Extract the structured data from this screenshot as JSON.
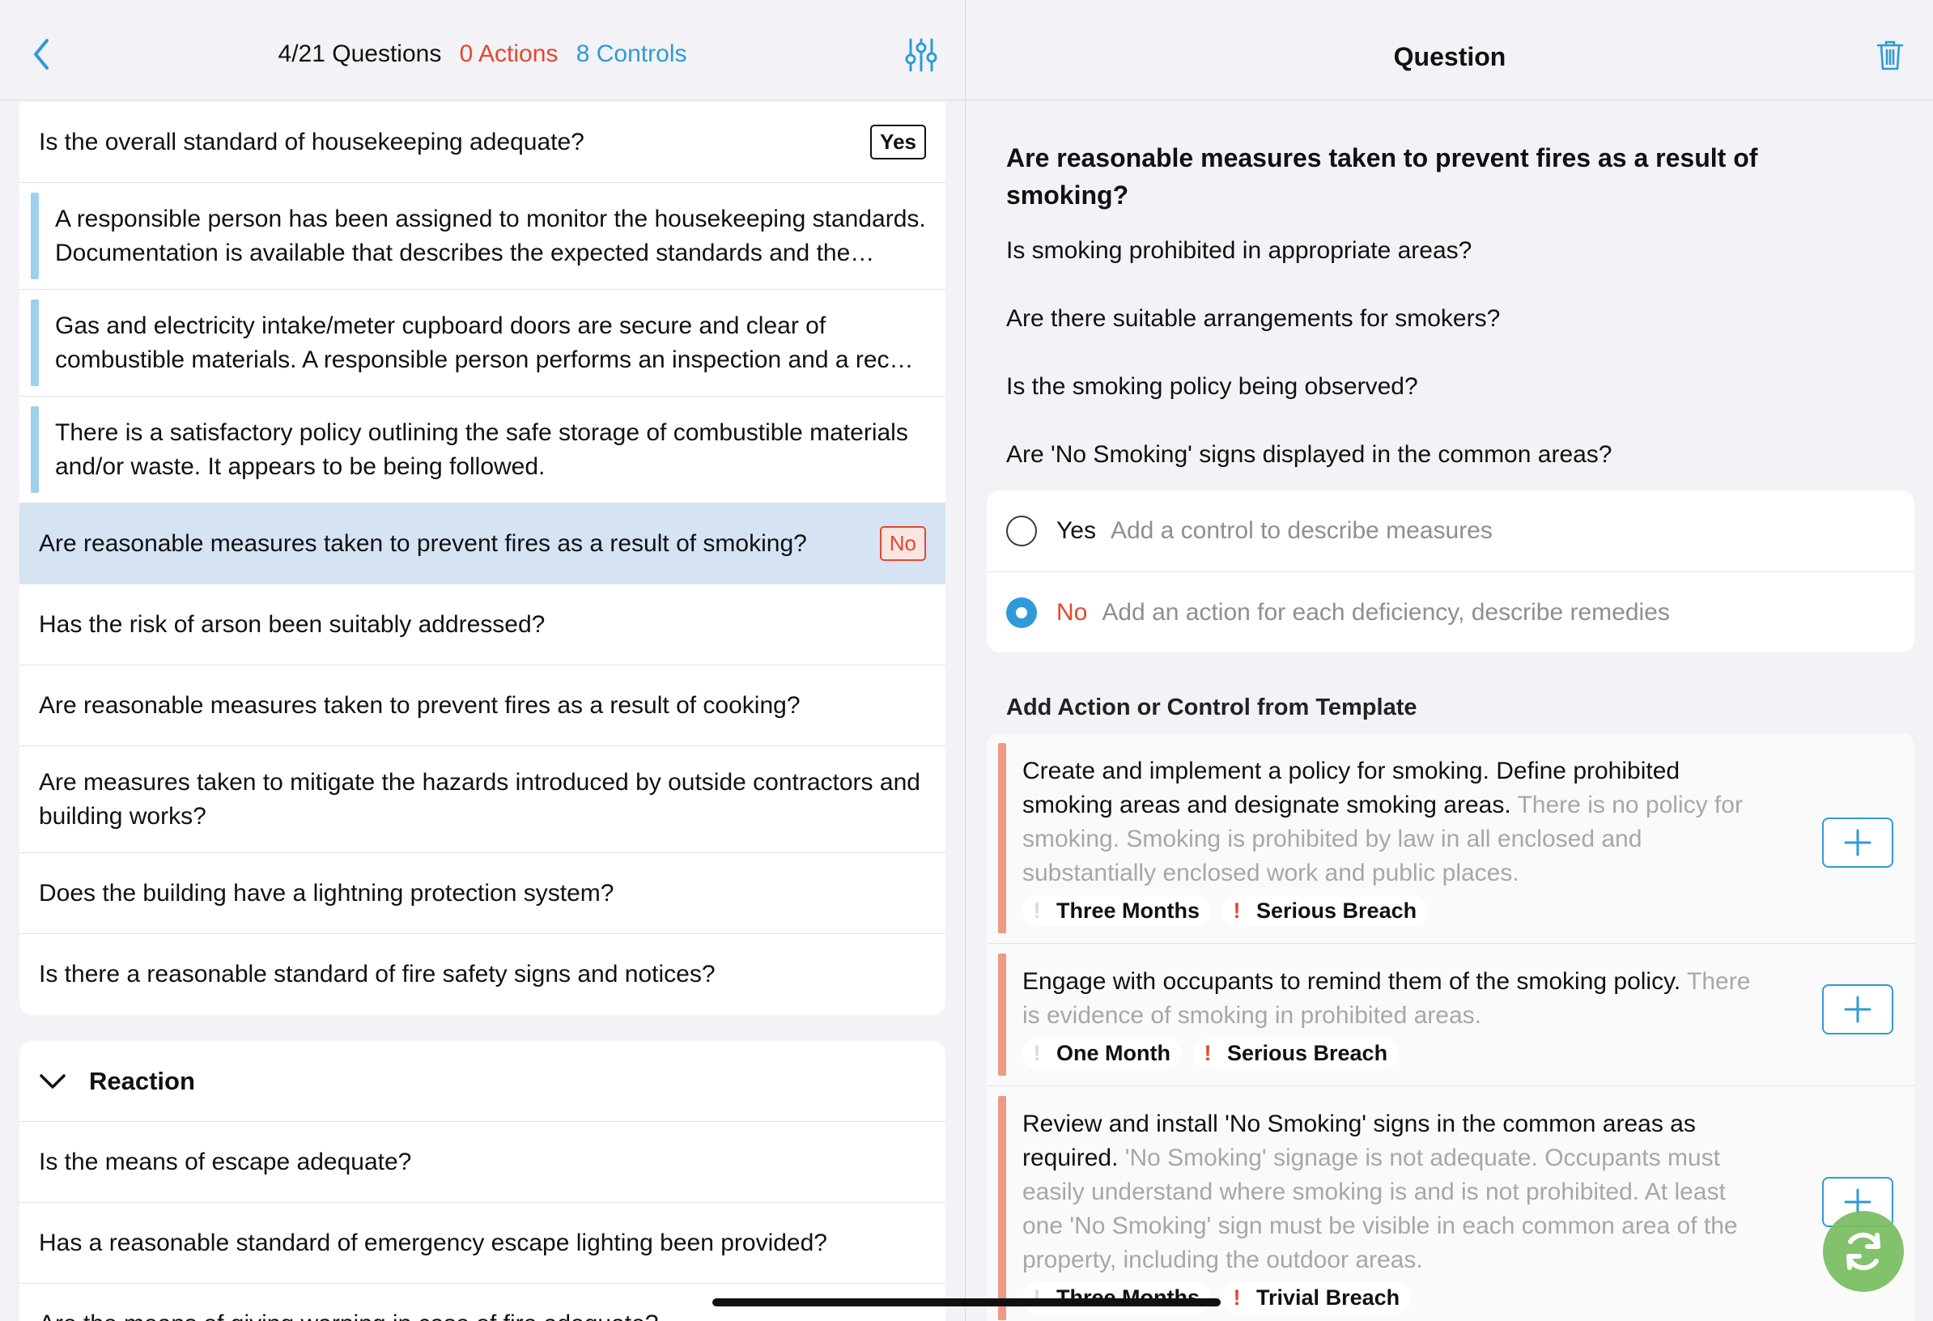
{
  "left_header": {
    "questions": "4/21 Questions",
    "actions": "0 Actions",
    "controls": "8 Controls",
    "back_icon": "chevron-left-icon",
    "filter_icon": "sliders-icon"
  },
  "list": {
    "row0": {
      "text": "Is the overall standard of housekeeping adequate?",
      "badge": "Yes"
    },
    "row1": {
      "text": "A responsible person has been assigned to monitor the housekeeping standards. Documentation is available that describes the expected standards and the inspection frequency."
    },
    "row2": {
      "text": "Gas and electricity intake/meter cupboard doors are secure and clear of combustible materials. A responsible person performs an inspection and a record is kept."
    },
    "row3": {
      "text": "There is a satisfactory policy outlining the safe storage of combustible materials and/or waste. It appears to be being followed."
    },
    "row4": {
      "text": "Are reasonable measures taken to prevent fires as a result of smoking?",
      "badge": "No"
    },
    "row5": {
      "text": "Has the risk of arson been suitably addressed?"
    },
    "row6": {
      "text": "Are reasonable measures taken to prevent fires as a result of cooking?"
    },
    "row7": {
      "text": "Are measures taken to mitigate the hazards introduced by outside contractors and building works?"
    },
    "row8": {
      "text": "Does the building have a lightning protection system?"
    },
    "row9": {
      "text": "Is there a reasonable standard of fire safety signs and notices?"
    }
  },
  "section": {
    "title": "Reaction",
    "chevron_icon": "chevron-down-icon",
    "row0": "Is the means of escape adequate?",
    "row1": "Has a reasonable standard of emergency escape lighting been provided?",
    "row2": "Are the means of giving warning in case of fire adequate?"
  },
  "right_header": {
    "title": "Question",
    "trash_icon": "trash-icon"
  },
  "question": {
    "title": "Are reasonable measures taken to prevent fires as a result of smoking?",
    "prompt0": "Is smoking prohibited in appropriate areas?",
    "prompt1": "Are there suitable arrangements for smokers?",
    "prompt2": "Is the smoking policy being observed?",
    "prompt3": "Are 'No Smoking' signs displayed in the common areas?"
  },
  "answers": {
    "yes": {
      "label": "Yes",
      "hint": "Add a control to describe measures",
      "selected": false
    },
    "no": {
      "label": "No",
      "hint": "Add an action for each deficiency, describe remedies",
      "selected": true
    }
  },
  "templates": {
    "label": "Add Action or Control from Template",
    "item0": {
      "main": "Create and implement a policy for smoking. Define prohibited smoking areas and designate smoking areas.",
      "detail": "There is no policy for smoking. Smoking is prohibited by law in all enclosed and substantially enclosed work and public places.",
      "timeframe": "Three Months",
      "severity": "Serious Breach"
    },
    "item1": {
      "main": "Engage with occupants to remind them of the smoking policy.",
      "detail": "There is evidence of smoking in prohibited areas.",
      "timeframe": "One Month",
      "severity": "Serious Breach"
    },
    "item2": {
      "main": "Review and install 'No Smoking' signs in the common areas as required.",
      "detail": "'No Smoking' signage is not adequate. Occupants must easily understand where smoking is and is not prohibited. At least one 'No Smoking' sign must be visible in each common area of the property, including the outdoor areas.",
      "timeframe": "Three Months",
      "severity": "Trivial Breach"
    },
    "add_icon": "plus-icon"
  },
  "fab_icon": "sync-icon",
  "colors": {
    "accent_blue": "#2e9bd6",
    "action_red": "#e2482f",
    "control_bar": "#9dd0ec",
    "action_bar": "#ef9a82",
    "selected_row": "#d5e3f3",
    "sync_green": "#7bbf63"
  }
}
